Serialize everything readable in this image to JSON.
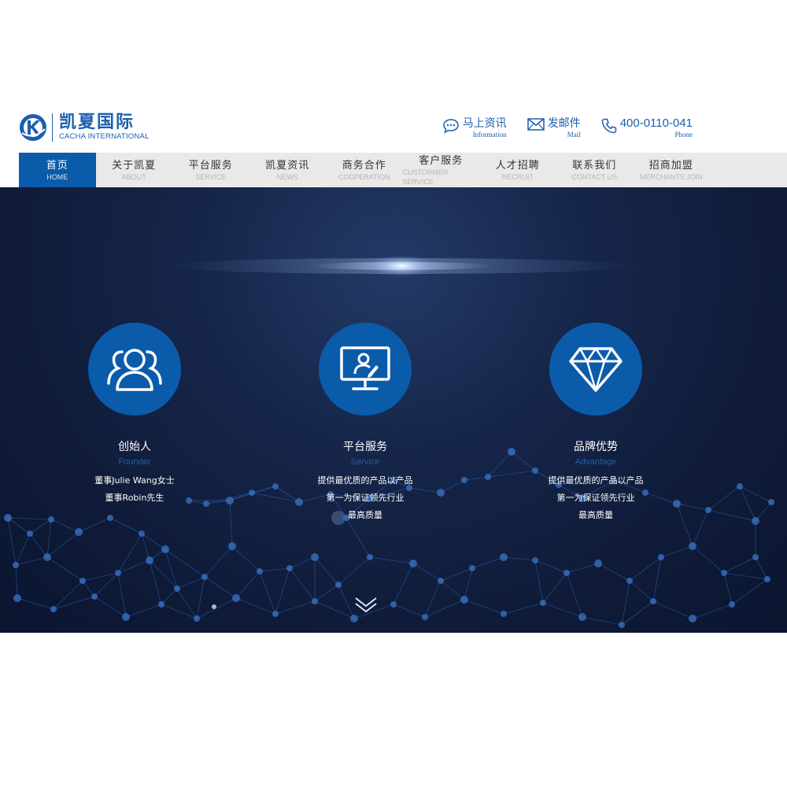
{
  "logo": {
    "cn": "凯夏国际",
    "en": "CACHA INTERNATIONAL"
  },
  "contacts": [
    {
      "icon": "chat-icon",
      "main": "马上资讯",
      "sub": "Information"
    },
    {
      "icon": "mail-icon",
      "main": "发邮件",
      "sub": "Mail"
    },
    {
      "icon": "phone-icon",
      "main": "400-0110-041",
      "sub": "Phone"
    }
  ],
  "nav": [
    {
      "cn": "首页",
      "en": "HOME",
      "active": true
    },
    {
      "cn": "关于凯夏",
      "en": "ABOUT"
    },
    {
      "cn": "平台服务",
      "en": "SERVICE"
    },
    {
      "cn": "凯夏资讯",
      "en": "NEWS"
    },
    {
      "cn": "商务合作",
      "en": "COOPERATION"
    },
    {
      "cn": "客户服务",
      "en": "CUSTORMER SERVICE"
    },
    {
      "cn": "人才招聘",
      "en": "RECRUIT"
    },
    {
      "cn": "联系我们",
      "en": "CONTACT US"
    },
    {
      "cn": "招商加盟",
      "en": "MERCHANTS JOIN"
    }
  ],
  "features": [
    {
      "icon": "users-icon",
      "title": "创始人",
      "sub": "Founder",
      "lines": [
        "董事Julie Wang女士",
        "董事Robin先生"
      ]
    },
    {
      "icon": "monitor-user-icon",
      "title": "平台服务",
      "sub": "Service",
      "lines": [
        "提供最优质的产品以产品",
        "第一为保证领先行业",
        "最高质量"
      ]
    },
    {
      "icon": "diamond-icon",
      "title": "品牌优势",
      "sub": "Advantage",
      "lines": [
        "提供最优质的产品以产品",
        "第一为保证领先行业",
        "最高质量"
      ]
    }
  ],
  "colors": {
    "brand": "#0b5bab",
    "nav_bg": "#e9e9e9",
    "banner_bg": "#13224a"
  }
}
